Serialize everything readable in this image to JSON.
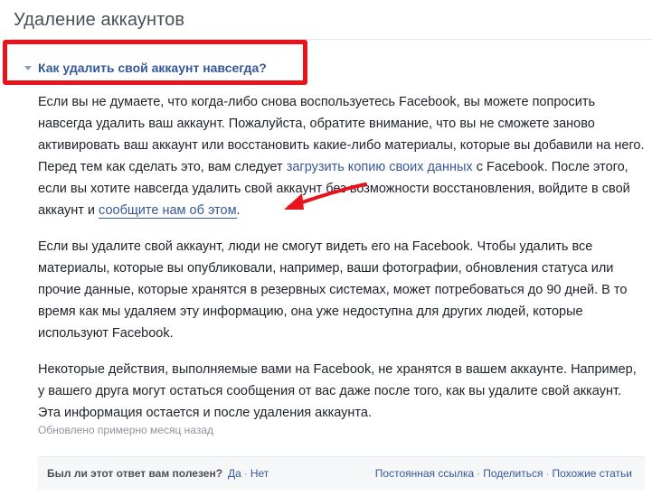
{
  "page": {
    "title": "Удаление аккаунтов"
  },
  "question": {
    "title": "Как удалить свой аккаунт навсегда?",
    "icon": "triangle-down-icon",
    "highlight_color": "#e8141c"
  },
  "article": {
    "p1": {
      "before_link1": "Если вы не думаете, что когда-либо снова воспользуетесь Facebook, вы можете попросить навсегда удалить ваш аккаунт. Пожалуйста, обратите внимание, что вы не сможете заново активировать ваш аккаунт или восстановить какие-либо материалы, которые вы добавили на него. Перед тем как сделать это, вам следует ",
      "link1": "загрузить копию своих данных",
      "between_links": " с Facebook. После этого, если вы хотите навсегда удалить свой аккаунт без возможности восстановления, войдите в свой аккаунт и ",
      "link2": "сообщите нам об этом",
      "end": "."
    },
    "p2": "Если вы удалите свой аккаунт, люди не смогут видеть его на Facebook. Чтобы удалить все материалы, которые вы опубликовали, например, ваши фотографии, обновления статуса или прочие данные, которые хранятся в резервных системах, может потребоваться до 90 дней. В то время как мы удаляем эту информацию, она уже недоступна для других людей, которые используют Facebook.",
    "p3": "Некоторые действия, выполняемые вами на Facebook, не хранятся в вашем аккаунте. Например, у вашего друга могут остаться сообщения от вас даже после того, как вы удалите свой аккаунт. Эта информация остается и после удаления аккаунта.",
    "updated": "Обновлено примерно месяц назад"
  },
  "annotation": {
    "arrow_color": "#e8141c"
  },
  "feedback": {
    "question": "Был ли этот ответ вам полезен?",
    "yes": "Да",
    "separator": "·",
    "no": "Нет",
    "permalink": "Постоянная ссылка",
    "share": "Поделиться",
    "related": "Похожие статьи"
  },
  "colors": {
    "link": "#365899",
    "text": "#1d2129",
    "muted": "#90949c"
  }
}
